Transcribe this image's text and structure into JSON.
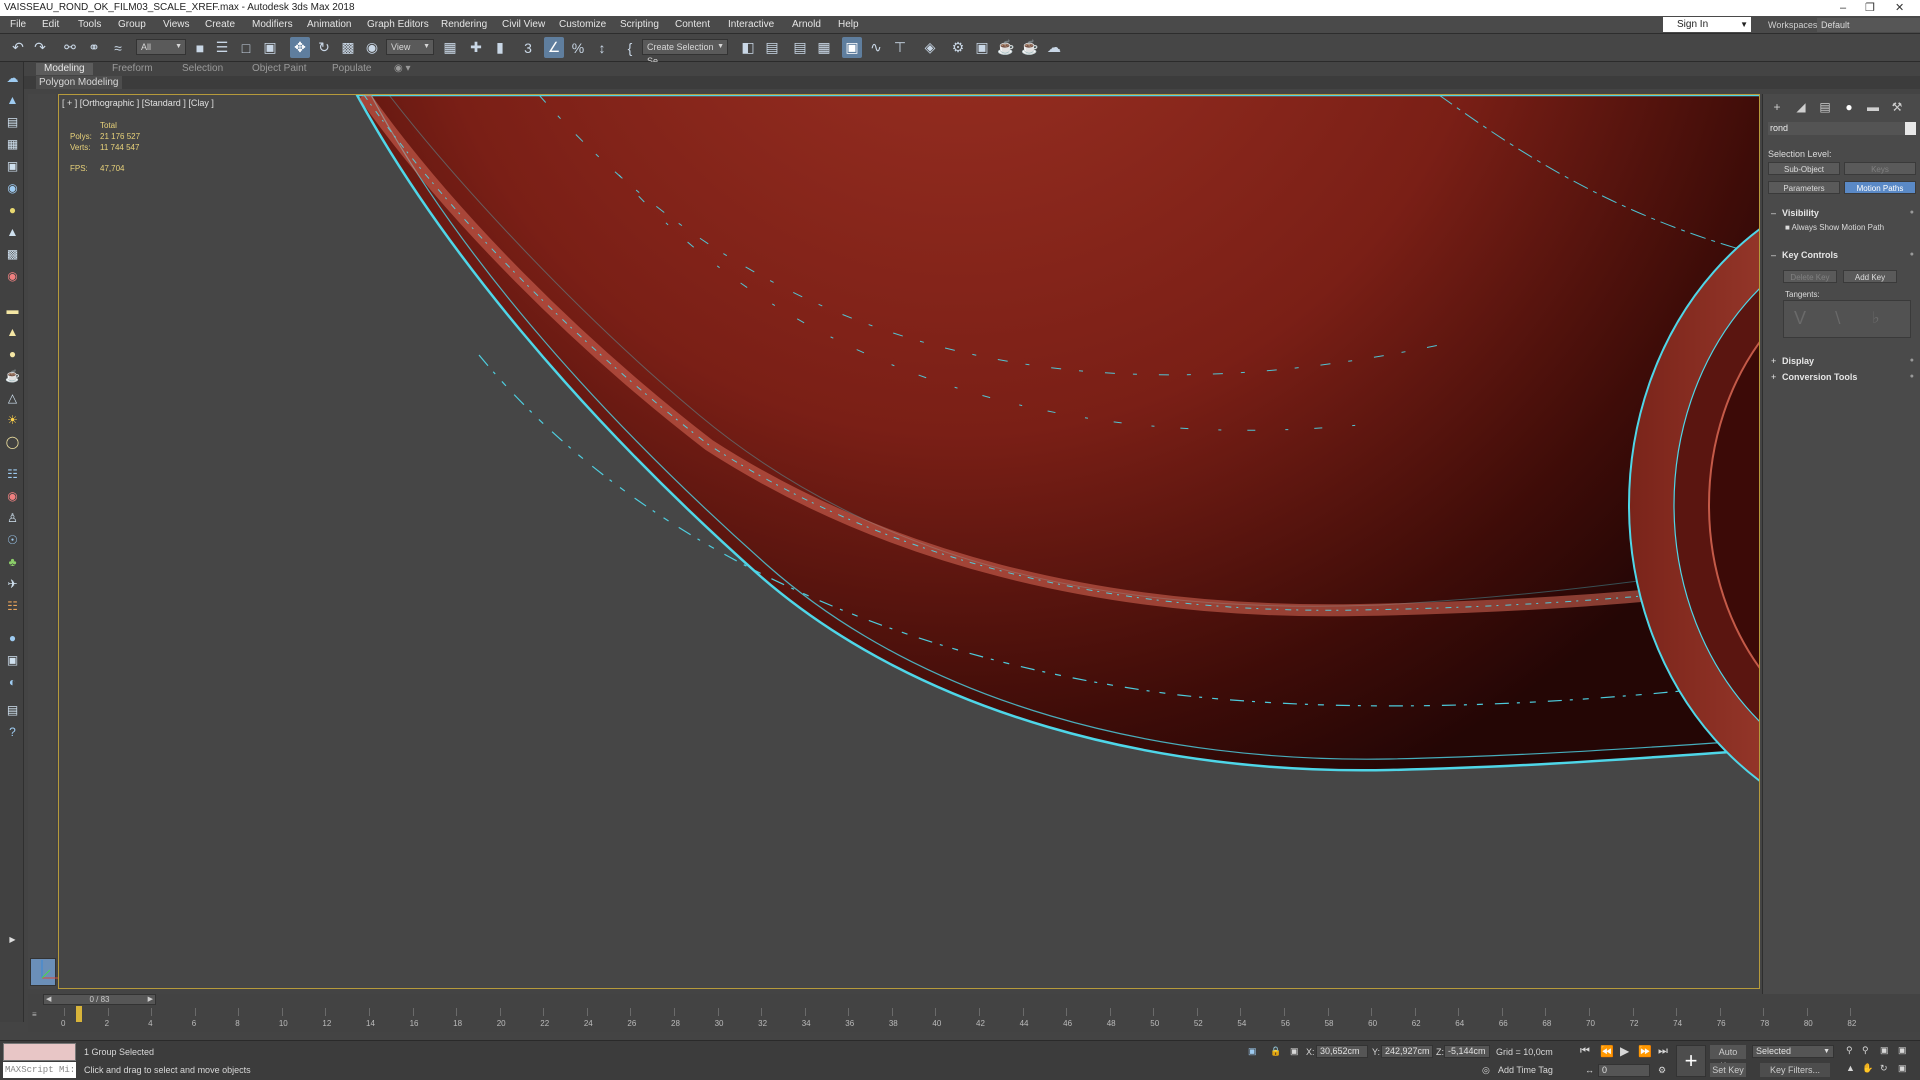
{
  "window": {
    "title": "VAISSEAU_ROND_OK_FILM03_SCALE_XREF.max - Autodesk 3ds Max 2018"
  },
  "menu": [
    "File",
    "Edit",
    "Tools",
    "Group",
    "Views",
    "Create",
    "Modifiers",
    "Animation",
    "Graph Editors",
    "Rendering",
    "Civil View",
    "Customize",
    "Scripting",
    "Content",
    "Interactive",
    "Arnold",
    "Help"
  ],
  "account": {
    "sign_in": "Sign In",
    "workspaces_label": "Workspaces:",
    "workspace": "Default"
  },
  "toolbar": {
    "selection_filter": "All",
    "ref_coord": "View",
    "named_selection": "Create Selection Se"
  },
  "ribbon": {
    "tabs": [
      "Modeling",
      "Freeform",
      "Selection",
      "Object Paint",
      "Populate"
    ],
    "active_tab": "Modeling",
    "subpanel": "Polygon Modeling"
  },
  "viewport": {
    "label": "[ + ] [Orthographic ] [Standard ] [Clay ]",
    "stats": {
      "header": "Total",
      "polys_label": "Polys:",
      "polys": "21 176 527",
      "verts_label": "Verts:",
      "verts": "11 744 547",
      "fps_label": "FPS:",
      "fps": "47,704"
    },
    "colors": {
      "hull": "#8a2a1e",
      "edges": "#4fd6e8",
      "background": "#464646",
      "active_border": "#b69a3b"
    }
  },
  "command_panel": {
    "object_name": "rond",
    "selection_level_label": "Selection Level:",
    "sub_object": "Sub-Object",
    "keys": "Keys",
    "parameters": "Parameters",
    "motion_paths": "Motion Paths",
    "visibility": "Visibility",
    "always_show": "Always Show Motion Path",
    "key_controls": "Key Controls",
    "delete_key": "Delete Key",
    "add_key": "Add Key",
    "tangents": "Tangents:",
    "display": "Display",
    "conversion_tools": "Conversion Tools"
  },
  "timeline": {
    "slider": "0 / 83",
    "ticks": [
      "0",
      "2",
      "4",
      "6",
      "8",
      "10",
      "12",
      "14",
      "16",
      "18",
      "20",
      "22",
      "24",
      "26",
      "28",
      "30",
      "32",
      "34",
      "36",
      "38",
      "40",
      "42",
      "44",
      "46",
      "48",
      "50",
      "52",
      "54",
      "56",
      "58",
      "60",
      "62",
      "64",
      "66",
      "68",
      "70",
      "72",
      "74",
      "76",
      "78",
      "80",
      "82"
    ]
  },
  "status": {
    "maxscript": "MAXScript Mi:",
    "selected": "1 Group Selected",
    "prompt": "Click and drag to select and move objects",
    "x_label": "X:",
    "x": "30,652cm",
    "y_label": "Y:",
    "y": "242,927cm",
    "z_label": "Z:",
    "z": "-5,144cm",
    "grid": "Grid = 10,0cm",
    "add_time_tag": "Add Time Tag",
    "auto_key": "Auto Key",
    "selected_set": "Selected",
    "set_key": "Set Key",
    "key_filters": "Key Filters...",
    "frame": "0"
  }
}
